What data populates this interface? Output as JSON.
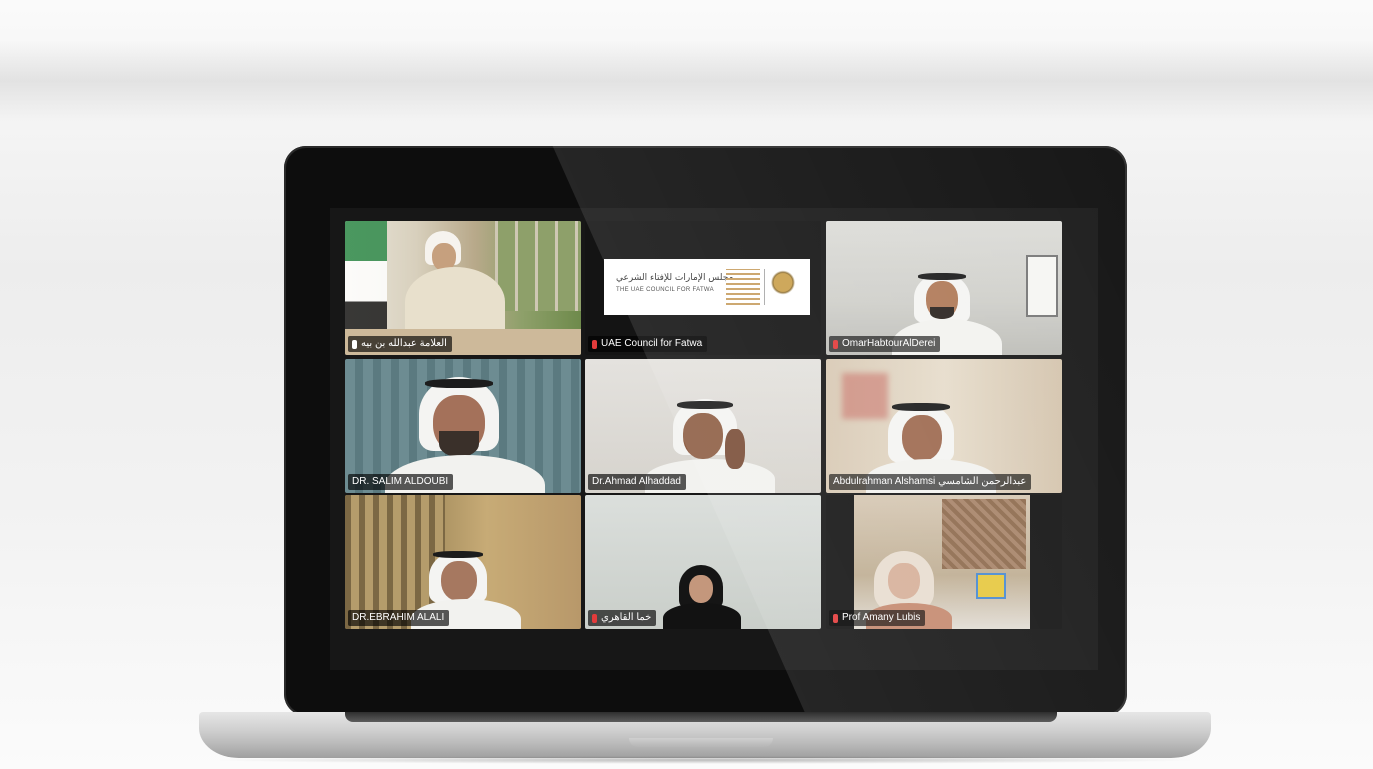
{
  "meeting": {
    "participants": [
      {
        "name": "العلامة عبدالله بن بيه",
        "mic_state": "on",
        "icon": "mic-icon"
      },
      {
        "name": "UAE Council for Fatwa",
        "mic_state": "muted",
        "icon": "mic-muted-icon"
      },
      {
        "name": "OmarHabtourAlDerei",
        "mic_state": "muted",
        "icon": "mic-muted-icon"
      },
      {
        "name": "DR. SALIM ALDOUBI",
        "mic_state": "none",
        "icon": ""
      },
      {
        "name": "Dr.Ahmad Alhaddad",
        "mic_state": "none",
        "icon": ""
      },
      {
        "name": "Abdulrahman Alshamsi عبدالرحمن الشامسي",
        "mic_state": "none",
        "icon": ""
      },
      {
        "name": "DR.EBRAHIM ALALI",
        "mic_state": "none",
        "icon": ""
      },
      {
        "name": "خما القاهري",
        "mic_state": "muted",
        "icon": "mic-muted-icon"
      },
      {
        "name": "Prof Amany Lubis",
        "mic_state": "muted",
        "icon": "mic-muted-icon"
      }
    ],
    "logo": {
      "arabic": "مجلس الإمارات للإفتاء الشرعي",
      "english": "THE UAE COUNCIL FOR FATWA"
    }
  },
  "colors": {
    "muted_mic": "#e23b3b",
    "name_tag_bg": "rgba(0,0,0,0.65)",
    "lid": "#0d0d0d",
    "logo_gold": "#c8a063"
  }
}
